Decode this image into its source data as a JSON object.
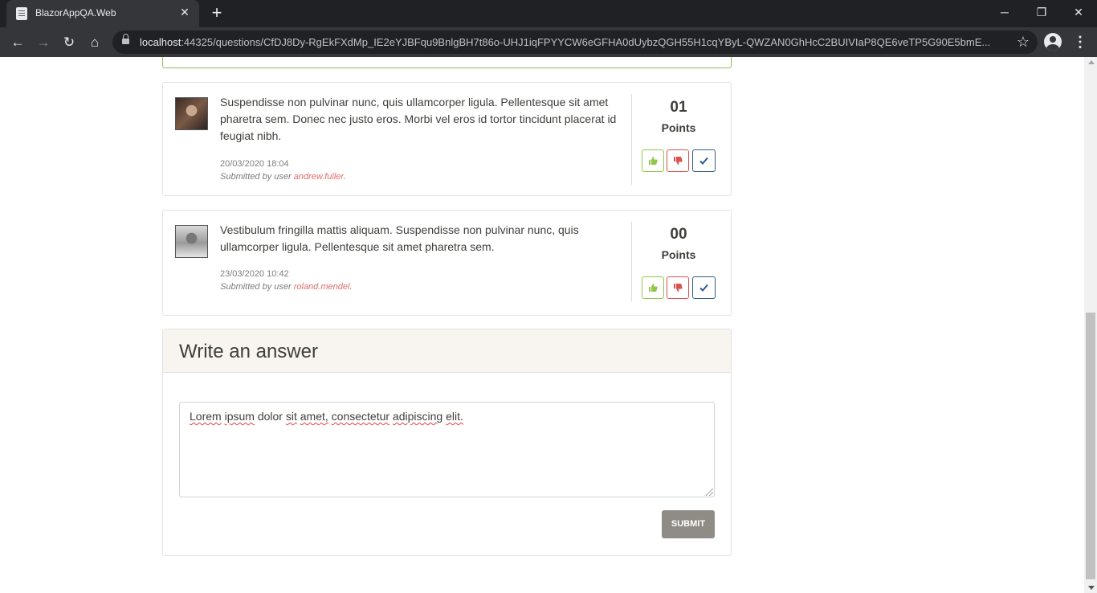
{
  "browser": {
    "tab_title": "BlazorAppQA.Web",
    "url_host": "localhost",
    "url_rest": ":44325/questions/CfDJ8Dy-RgEkFXdMp_IE2eYJBFqu9BnlgBH7t86o-UHJ1iqFPYYCW6eGFHA0dUybzQGH55H1cqYByL-QWZAN0GhHcC2BUIVIaP8QE6veTP5G90E5bmE..."
  },
  "answers": [
    {
      "text": "Suspendisse non pulvinar nunc, quis ullamcorper ligula. Pellentesque sit amet pharetra sem. Donec nec justo eros. Morbi vel eros id tortor tincidunt placerat id feugiat nibh.",
      "date": "20/03/2020 18:04",
      "submitted_prefix": "Submitted by user ",
      "user": "andrew.fuller",
      "points": "01",
      "points_label": "Points"
    },
    {
      "text": "Vestibulum fringilla mattis aliquam. Suspendisse non pulvinar nunc, quis ullamcorper ligula. Pellentesque sit amet pharetra sem.",
      "date": "23/03/2020 10:42",
      "submitted_prefix": "Submitted by user ",
      "user": "roland.mendel",
      "points": "00",
      "points_label": "Points"
    }
  ],
  "write_answer": {
    "title": "Write an answer",
    "input_words": [
      "Lorem",
      "ipsum",
      "dolor",
      "sit",
      "amet,",
      "consectetur",
      "adipiscing",
      "elit."
    ],
    "submit_label": "SUBMIT"
  },
  "colors": {
    "upvote": "#93c54b",
    "downvote": "#d9534f",
    "accept": "#325d88",
    "submit": "#8e8c84"
  }
}
